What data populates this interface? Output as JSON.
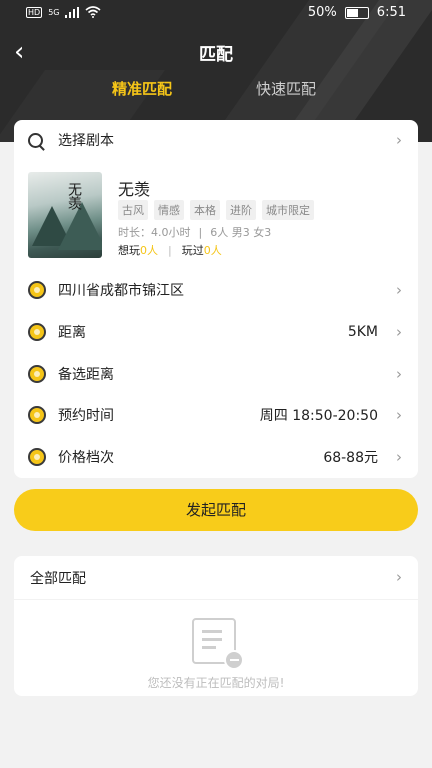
{
  "status_bar": {
    "network_left": "HD",
    "signal_label": "5G",
    "battery": "50%",
    "time": "6:51"
  },
  "header": {
    "back_glyph": "‹",
    "title": "匹配"
  },
  "tabs": [
    {
      "label": "精准匹配",
      "active": true
    },
    {
      "label": "快速匹配",
      "active": false
    }
  ],
  "script_select": {
    "label": "选择剧本"
  },
  "script": {
    "cover_title": "无羡",
    "name": "无羡",
    "tags": [
      "古风",
      "情感",
      "本格",
      "进阶",
      "城市限定"
    ],
    "duration": "时长：4.0小时",
    "players": "6人 男3 女3",
    "want_label": "想玩",
    "want_count": "0人",
    "played_label": "玩过",
    "played_count": "0人"
  },
  "filters": {
    "location": "四川省成都市锦江区",
    "distance_label": "距离",
    "distance_value": "5KM",
    "alt_distance_label": "备选距离",
    "time_label": "预约时间",
    "time_value": "周四 18:50-20:50",
    "price_label": "价格档次",
    "price_value": "68-88元"
  },
  "primary_button": "发起匹配",
  "all_matches": {
    "label": "全部匹配",
    "empty_text": "您还没有正在匹配的对局!"
  },
  "colors": {
    "accent": "#f5c518",
    "button": "#f8cc1a",
    "header_bg": "#2b2b2b"
  }
}
